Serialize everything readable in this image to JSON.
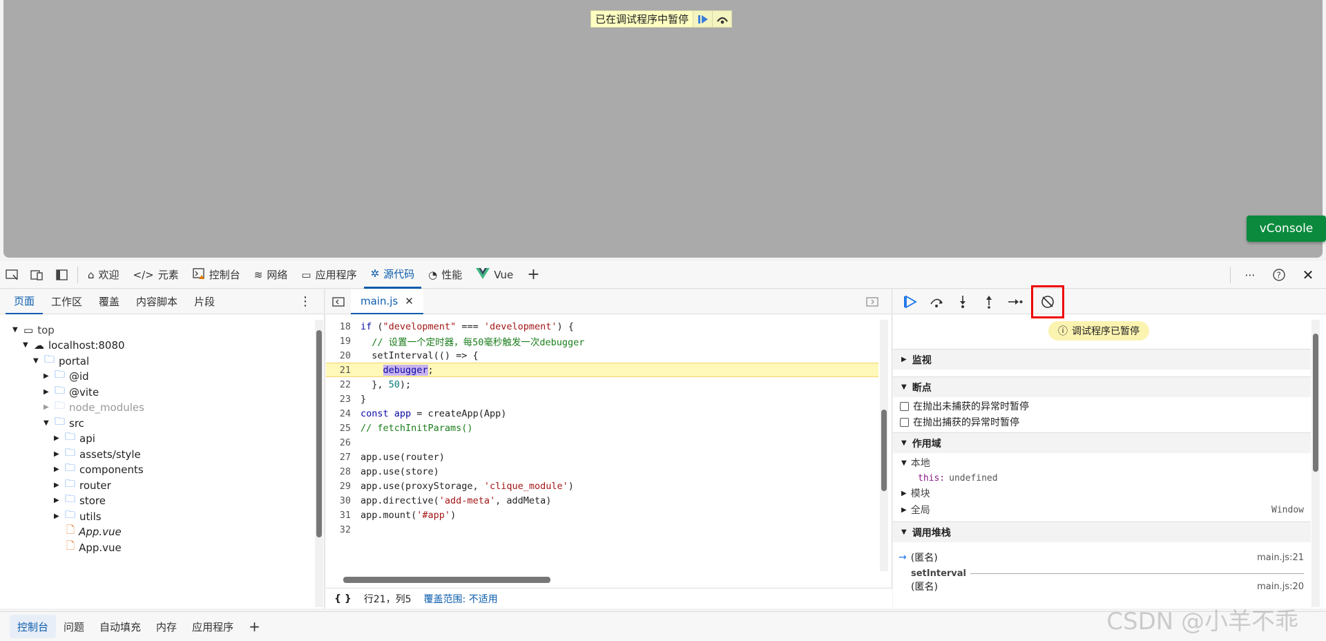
{
  "viewport": {
    "paused_label": "已在调试程序中暂停",
    "vconsole_label": "vConsole"
  },
  "toolbar": {
    "tabs": [
      "欢迎",
      "元素",
      "控制台",
      "网络",
      "应用程序",
      "源代码",
      "性能",
      "Vue"
    ],
    "active_tab": "源代码"
  },
  "sources": {
    "subtabs": [
      "页面",
      "工作区",
      "覆盖",
      "内容脚本",
      "片段"
    ],
    "tree": [
      {
        "label": "top"
      },
      {
        "label": "localhost:8080"
      },
      {
        "label": "portal"
      },
      {
        "label": "@id"
      },
      {
        "label": "@vite"
      },
      {
        "label": "node_modules"
      },
      {
        "label": "src"
      },
      {
        "label": "api"
      },
      {
        "label": "assets/style"
      },
      {
        "label": "components"
      },
      {
        "label": "router"
      },
      {
        "label": "store"
      },
      {
        "label": "utils"
      },
      {
        "label": "App.vue"
      },
      {
        "label": "App.vue"
      }
    ]
  },
  "editor": {
    "file_tab": "main.js",
    "line_numbers": [
      "18",
      "19",
      "20",
      "21",
      "22",
      "23",
      "24",
      "25",
      "26",
      "27",
      "28",
      "29",
      "30",
      "31",
      "32"
    ],
    "status_braces": "{ }",
    "status_position": "行21，列5",
    "coverage_label": "覆盖范围: 不适用"
  },
  "debugger": {
    "paused_pill": "调试程序已暂停",
    "watch": "监视",
    "breakpoints": "断点",
    "bp_uncaught": "在抛出未捕获的异常时暂停",
    "bp_caught": "在抛出捕获的异常时暂停",
    "scope": "作用域",
    "local": "本地",
    "this_key": "this:",
    "this_val": "undefined",
    "module": "模块",
    "global": "全局",
    "global_val": "Window",
    "callstack": "调用堆栈",
    "frame1_name": "(匿名)",
    "frame1_loc": "main.js:21",
    "frame_sep": "setInterval",
    "frame2_name": "(匿名)",
    "frame2_loc": "main.js:20"
  },
  "bottom": {
    "tabs": [
      "控制台",
      "问题",
      "自动填充",
      "内存",
      "应用程序"
    ],
    "watermark": "CSDN @小羊不乖"
  }
}
